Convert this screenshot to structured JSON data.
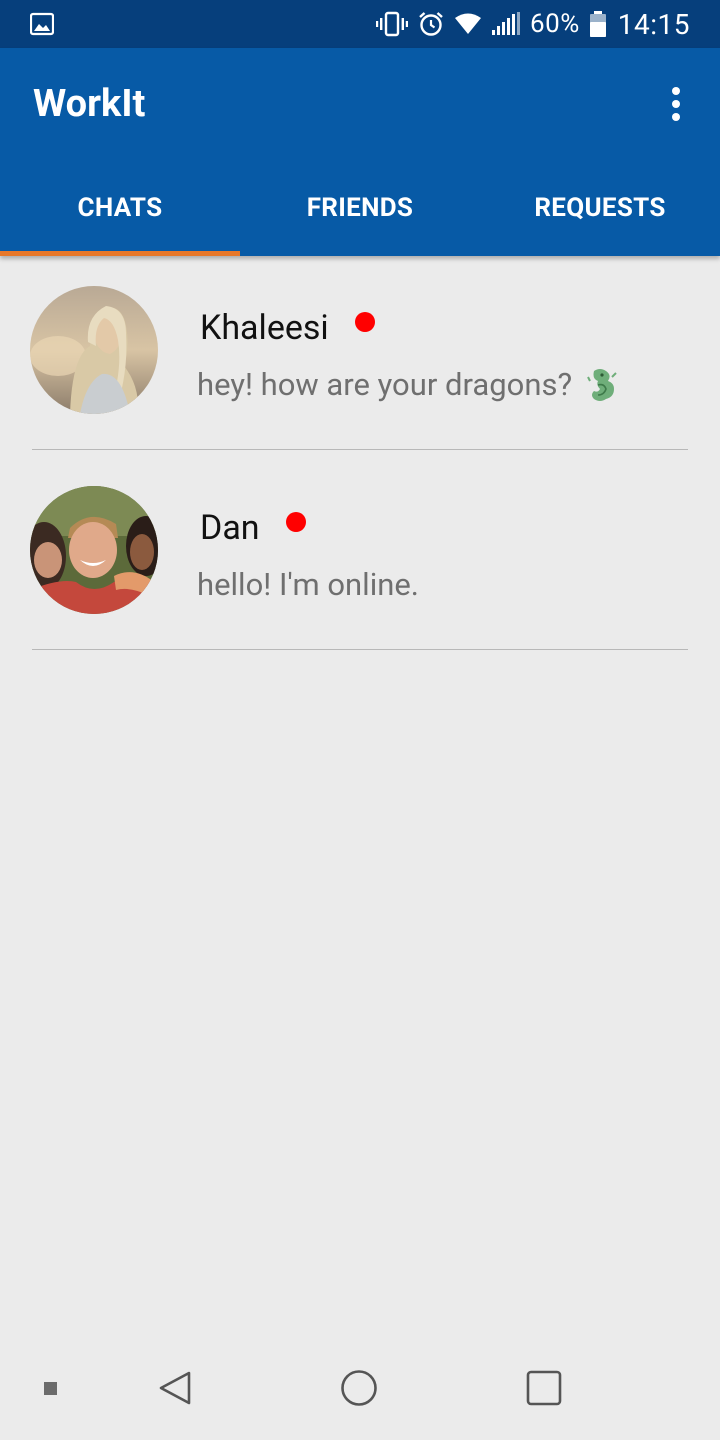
{
  "status_bar": {
    "battery_percent": "60%",
    "time": "14:15",
    "icons": [
      "gallery-icon",
      "vibrate-icon",
      "alarm-icon",
      "wifi-icon",
      "signal-icon",
      "battery-icon"
    ]
  },
  "app_bar": {
    "title": "WorkIt",
    "menu_icon": "more-vert-icon",
    "color": "#075aa6"
  },
  "tabs": [
    {
      "label": "CHATS",
      "selected": true
    },
    {
      "label": "FRIENDS",
      "selected": false
    },
    {
      "label": "REQUESTS",
      "selected": false
    }
  ],
  "tab_indicator_color": "#e8782a",
  "chats": [
    {
      "name": "Khaleesi",
      "message": "hey! how are your dragons?",
      "online": true,
      "emoji_icon": "dragon-icon"
    },
    {
      "name": "Dan",
      "message": "hello! I'm online.",
      "online": true
    }
  ],
  "online_color": "#ff0000",
  "nav_bar": {
    "icons": [
      "notification-dot-icon",
      "back-icon",
      "home-icon",
      "recents-icon"
    ]
  }
}
